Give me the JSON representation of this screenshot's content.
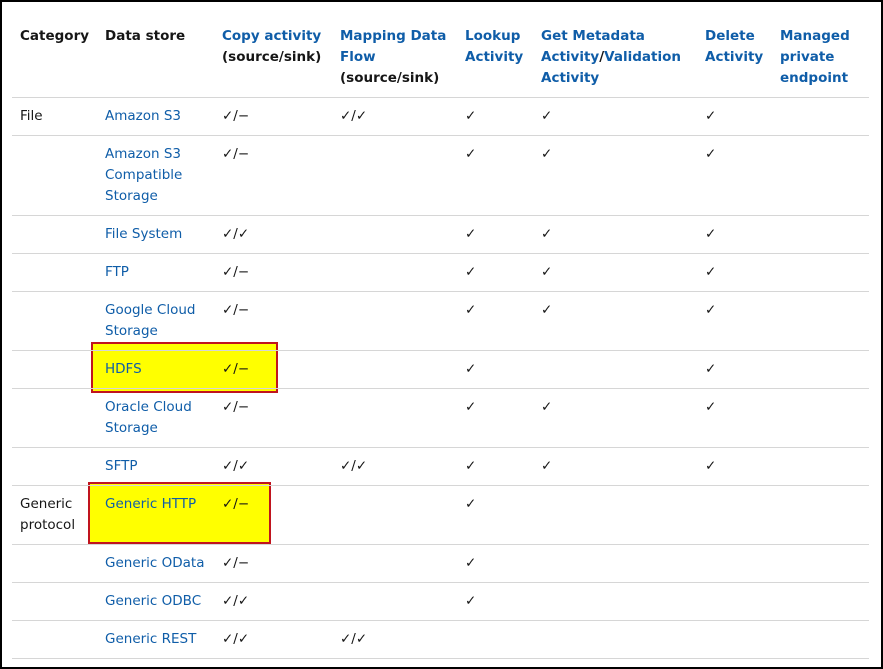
{
  "headers": {
    "category": "Category",
    "data_store": "Data store",
    "copy_activity": "Copy activity",
    "copy_activity_sub": "(source/sink)",
    "mapping_flow": "Mapping Data Flow",
    "mapping_flow_sub": "(source/sink)",
    "lookup": "Lookup Activity",
    "get_metadata": "Get Metadata Activity",
    "slash": "/",
    "validation": "Validation Activity",
    "delete": "Delete Activity",
    "managed": "Managed private endpoint"
  },
  "rows": [
    {
      "category": "File",
      "store": "Amazon S3",
      "copy": "✓/−",
      "mapping": "✓/✓",
      "lookup": "✓",
      "meta": "✓",
      "delete": "✓",
      "managed": ""
    },
    {
      "category": "",
      "store": "Amazon S3 Compatible Storage",
      "copy": "✓/−",
      "mapping": "",
      "lookup": "✓",
      "meta": "✓",
      "delete": "✓",
      "managed": ""
    },
    {
      "category": "",
      "store": "File System",
      "copy": "✓/✓",
      "mapping": "",
      "lookup": "✓",
      "meta": "✓",
      "delete": "✓",
      "managed": ""
    },
    {
      "category": "",
      "store": "FTP",
      "copy": "✓/−",
      "mapping": "",
      "lookup": "✓",
      "meta": "✓",
      "delete": "✓",
      "managed": ""
    },
    {
      "category": "",
      "store": "Google Cloud Storage",
      "copy": "✓/−",
      "mapping": "",
      "lookup": "✓",
      "meta": "✓",
      "delete": "✓",
      "managed": ""
    },
    {
      "category": "",
      "store": "HDFS",
      "copy": "✓/−",
      "mapping": "",
      "lookup": "✓",
      "meta": "",
      "delete": "✓",
      "managed": ""
    },
    {
      "category": "",
      "store": "Oracle Cloud Storage",
      "copy": "✓/−",
      "mapping": "",
      "lookup": "✓",
      "meta": "✓",
      "delete": "✓",
      "managed": ""
    },
    {
      "category": "",
      "store": "SFTP",
      "copy": "✓/✓",
      "mapping": "✓/✓",
      "lookup": "✓",
      "meta": "✓",
      "delete": "✓",
      "managed": ""
    },
    {
      "category": "Generic protocol",
      "store": "Generic HTTP",
      "copy": "✓/−",
      "mapping": "",
      "lookup": "✓",
      "meta": "",
      "delete": "",
      "managed": ""
    },
    {
      "category": "",
      "store": "Generic OData",
      "copy": "✓/−",
      "mapping": "",
      "lookup": "✓",
      "meta": "",
      "delete": "",
      "managed": ""
    },
    {
      "category": "",
      "store": "Generic ODBC",
      "copy": "✓/✓",
      "mapping": "",
      "lookup": "✓",
      "meta": "",
      "delete": "",
      "managed": ""
    },
    {
      "category": "",
      "store": "Generic REST",
      "copy": "✓/✓",
      "mapping": "✓/✓",
      "lookup": "",
      "meta": "",
      "delete": "",
      "managed": ""
    }
  ],
  "colors": {
    "link": "#0f5da8",
    "highlight_fill": "#ffff00",
    "highlight_border": "#c0141e"
  }
}
